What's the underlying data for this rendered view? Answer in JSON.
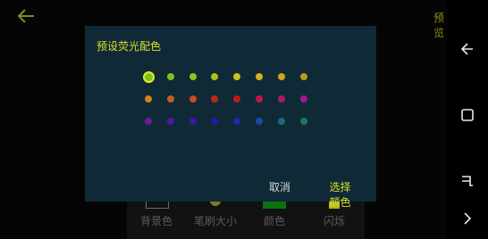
{
  "header": {
    "back_icon": "back-arrow-icon",
    "preview_label": "预览"
  },
  "toolbar": {
    "items": [
      {
        "label": "背景色",
        "icon": "background-swatch-icon"
      },
      {
        "label": "笔刷大小",
        "icon": "brush-size-icon"
      },
      {
        "label": "颜色",
        "icon": "color-swatch-icon",
        "color": "#0f6f0f"
      },
      {
        "label": "闪烁",
        "icon": "flash-icon",
        "color": "#b4b41e"
      }
    ]
  },
  "dialog": {
    "title": "预设荧光配色",
    "cancel_label": "取消",
    "pick_label": "选择颜色",
    "selected_index": 0,
    "palette": [
      [
        "#7cc41e",
        "#7cc41e",
        "#92c01c",
        "#b2c11c",
        "#c9c31c",
        "#d0b31b",
        "#c8a81a",
        "#b99a18"
      ],
      [
        "#c8861a",
        "#c0601a",
        "#c84a1a",
        "#b92a16",
        "#c01818",
        "#c01848",
        "#b0186c",
        "#a01a8a"
      ],
      [
        "#6a1a9a",
        "#52189a",
        "#3a18a2",
        "#2418a8",
        "#1a2aa8",
        "#1a4aa0",
        "#1a6a80",
        "#1a7a58"
      ]
    ]
  },
  "navbar": {
    "icons": [
      "back-nav-icon",
      "recents-icon",
      "rotate-icon",
      "forward-nav-icon"
    ]
  }
}
